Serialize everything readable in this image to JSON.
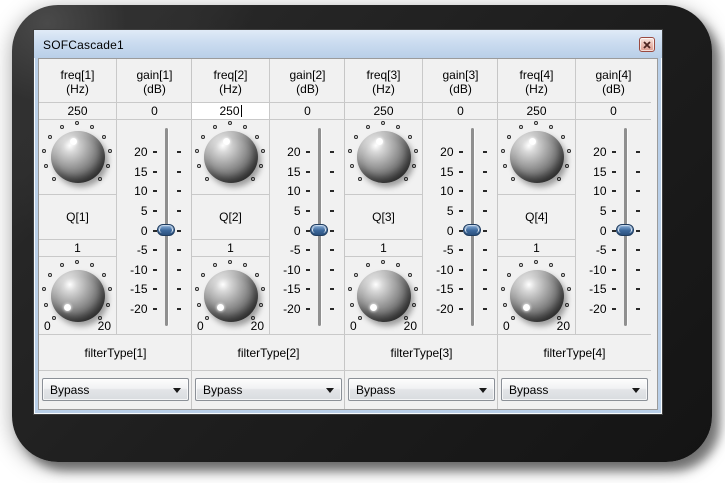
{
  "window": {
    "title": "SOFCascade1"
  },
  "slider_ticks": [
    "20",
    "15",
    "10",
    "5",
    "0",
    "-5",
    "-10",
    "-15",
    "-20"
  ],
  "groups": [
    {
      "freq_label": "freq[1]",
      "freq_unit": "(Hz)",
      "freq_value": "250",
      "gain_label": "gain[1]",
      "gain_unit": "(dB)",
      "gain_value": "0",
      "q_label": "Q[1]",
      "q_value": "1",
      "q_min": "0",
      "q_max": "20",
      "filter_label": "filterType[1]",
      "filter_value": "Bypass"
    },
    {
      "freq_label": "freq[2]",
      "freq_unit": "(Hz)",
      "freq_value": "250",
      "gain_label": "gain[2]",
      "gain_unit": "(dB)",
      "gain_value": "0",
      "q_label": "Q[2]",
      "q_value": "1",
      "q_min": "0",
      "q_max": "20",
      "filter_label": "filterType[2]",
      "filter_value": "Bypass"
    },
    {
      "freq_label": "freq[3]",
      "freq_unit": "(Hz)",
      "freq_value": "250",
      "gain_label": "gain[3]",
      "gain_unit": "(dB)",
      "gain_value": "0",
      "q_label": "Q[3]",
      "q_value": "1",
      "q_min": "0",
      "q_max": "20",
      "filter_label": "filterType[3]",
      "filter_value": "Bypass"
    },
    {
      "freq_label": "freq[4]",
      "freq_unit": "(Hz)",
      "freq_value": "250",
      "gain_label": "gain[4]",
      "gain_unit": "(dB)",
      "gain_value": "0",
      "q_label": "Q[4]",
      "q_value": "1",
      "q_min": "0",
      "q_max": "20",
      "filter_label": "filterType[4]",
      "filter_value": "Bypass"
    }
  ]
}
